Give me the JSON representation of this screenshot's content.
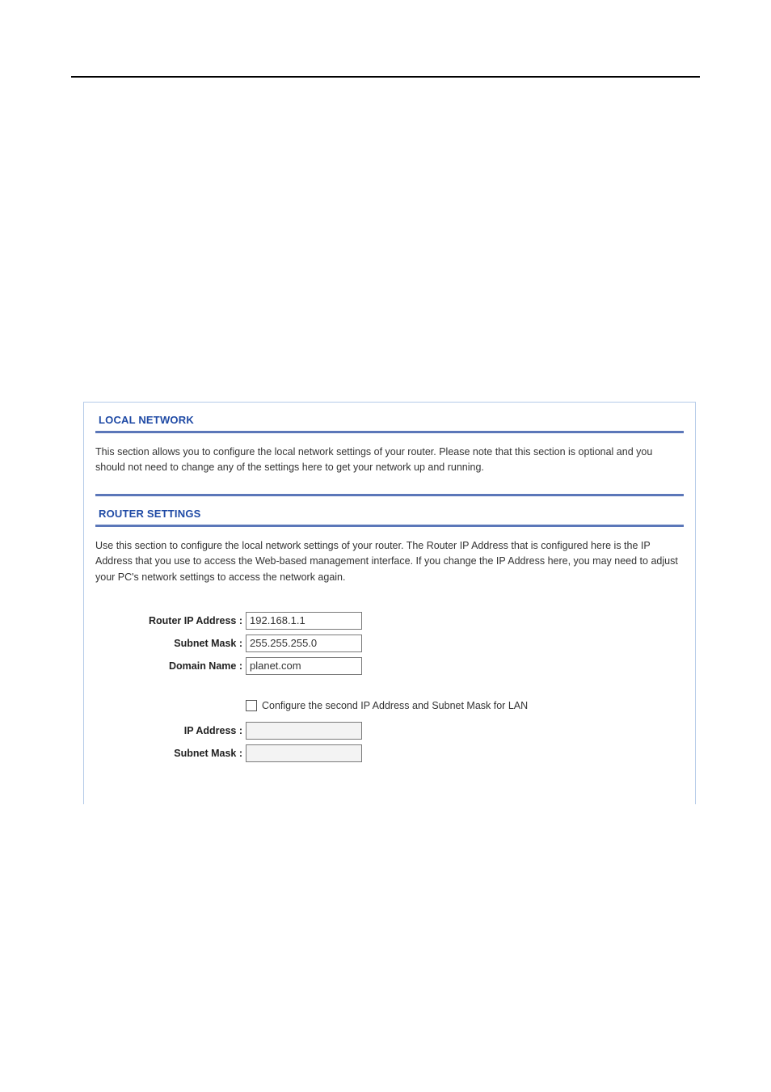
{
  "sections": {
    "local_network": {
      "title": "LOCAL NETWORK",
      "desc": "This section allows you to configure the local network settings of your router. Please note that this section is optional and you should not need to change any of the settings here to get your network up and running."
    },
    "router_settings": {
      "title": "ROUTER SETTINGS",
      "desc": "Use this section to configure the local network settings of your router. The Router IP Address that is configured here is the IP Address that you use to access the Web-based management interface. If you change the IP Address here, you may need to adjust your PC's network settings to access the network again."
    }
  },
  "form": {
    "router_ip_label": "Router IP Address :",
    "router_ip_value": "192.168.1.1",
    "subnet_mask_label": "Subnet Mask :",
    "subnet_mask_value": "255.255.255.0",
    "domain_name_label": "Domain Name :",
    "domain_name_value": "planet.com",
    "second_ip_checkbox_label": "Configure the second IP Address and Subnet Mask for LAN",
    "ip2_label": "IP Address :",
    "ip2_value": "",
    "mask2_label": "Subnet Mask :",
    "mask2_value": ""
  }
}
